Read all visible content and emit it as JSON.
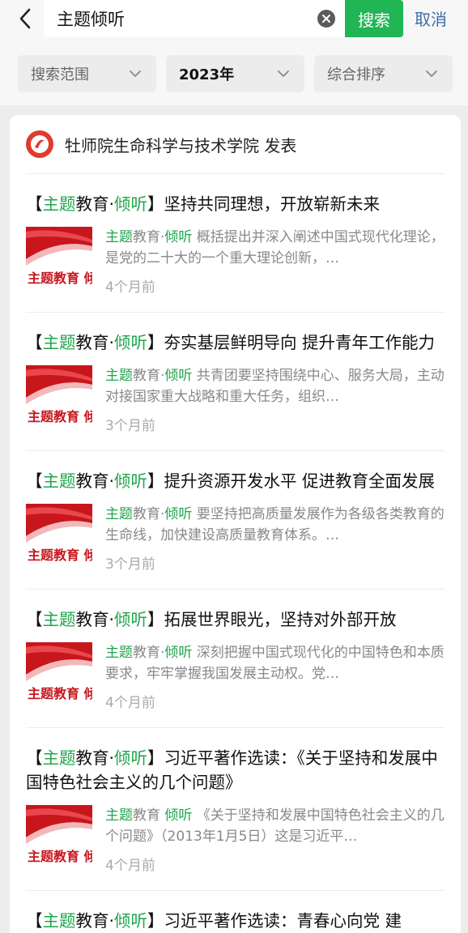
{
  "header": {
    "query": "主题倾听",
    "search_label": "搜索",
    "cancel_label": "取消"
  },
  "filters": [
    {
      "label": "搜索范围",
      "active": false
    },
    {
      "label": "2023年",
      "active": true
    },
    {
      "label": "综合排序",
      "active": false
    }
  ],
  "source": {
    "name": "牡师院生命科学与技术学院 发表"
  },
  "thumbnail_text": "主题教育 倾听",
  "colors": {
    "accent_green": "#20b654",
    "highlight_green": "#20a54c",
    "thumb_red": "#c8161d",
    "link_blue": "#3a6ea8"
  },
  "articles": [
    {
      "title_open": "【",
      "title_hl1": "主题",
      "title_mid": "教育·",
      "title_hl2": "倾听",
      "title_rest": "】坚持共同理想，开放崭新未来",
      "ex_hl1": "主题",
      "ex_mid": "教育·",
      "ex_hl2": "倾听",
      "ex_rest": " 概括提出并深入阐述中国式现代化理论，是党的二十大的一个重大理论创新，…",
      "time": "4个月前"
    },
    {
      "title_open": "【",
      "title_hl1": "主题",
      "title_mid": "教育·",
      "title_hl2": "倾听",
      "title_rest": "】夯实基层鲜明导向 提升青年工作能力",
      "ex_hl1": "主题",
      "ex_mid": "教育·",
      "ex_hl2": "倾听",
      "ex_rest": " 共青团要坚持围绕中心、服务大局，主动对接国家重大战略和重大任务，组织…",
      "time": "3个月前"
    },
    {
      "title_open": "【",
      "title_hl1": "主题",
      "title_mid": "教育·",
      "title_hl2": "倾听",
      "title_rest": "】提升资源开发水平 促进教育全面发展",
      "ex_hl1": "主题",
      "ex_mid": "教育·",
      "ex_hl2": "倾听",
      "ex_rest": " 要坚持把高质量发展作为各级各类教育的生命线，加快建设高质量教育体系。…",
      "time": "3个月前"
    },
    {
      "title_open": "【",
      "title_hl1": "主题",
      "title_mid": "教育·",
      "title_hl2": "倾听",
      "title_rest": "】拓展世界眼光，坚持对外部开放",
      "ex_hl1": "主题",
      "ex_mid": "教育·",
      "ex_hl2": "倾听",
      "ex_rest": " 深刻把握中国式现代化的中国特色和本质要求，牢牢掌握我国发展主动权。党…",
      "time": "4个月前"
    },
    {
      "title_open": "【",
      "title_hl1": "主题",
      "title_mid": "教育·",
      "title_hl2": "倾听",
      "title_rest": "】习近平著作选读：《关于坚持和发展中国特色社会主义的几个问题》",
      "ex_hl1": "主题",
      "ex_mid": "教育 ",
      "ex_hl2": "倾听",
      "ex_rest": " 《关于坚持和发展中国特色社会主义的几个问题》（2013年1月5日）这是习近平…",
      "time": "4个月前"
    },
    {
      "title_open": "【",
      "title_hl1": "主题",
      "title_mid": "教育·",
      "title_hl2": "倾听",
      "title_rest": "】习近平著作选读：青春心向党 建",
      "ex_hl1": "",
      "ex_mid": "",
      "ex_hl2": "",
      "ex_rest": "",
      "time": ""
    }
  ]
}
